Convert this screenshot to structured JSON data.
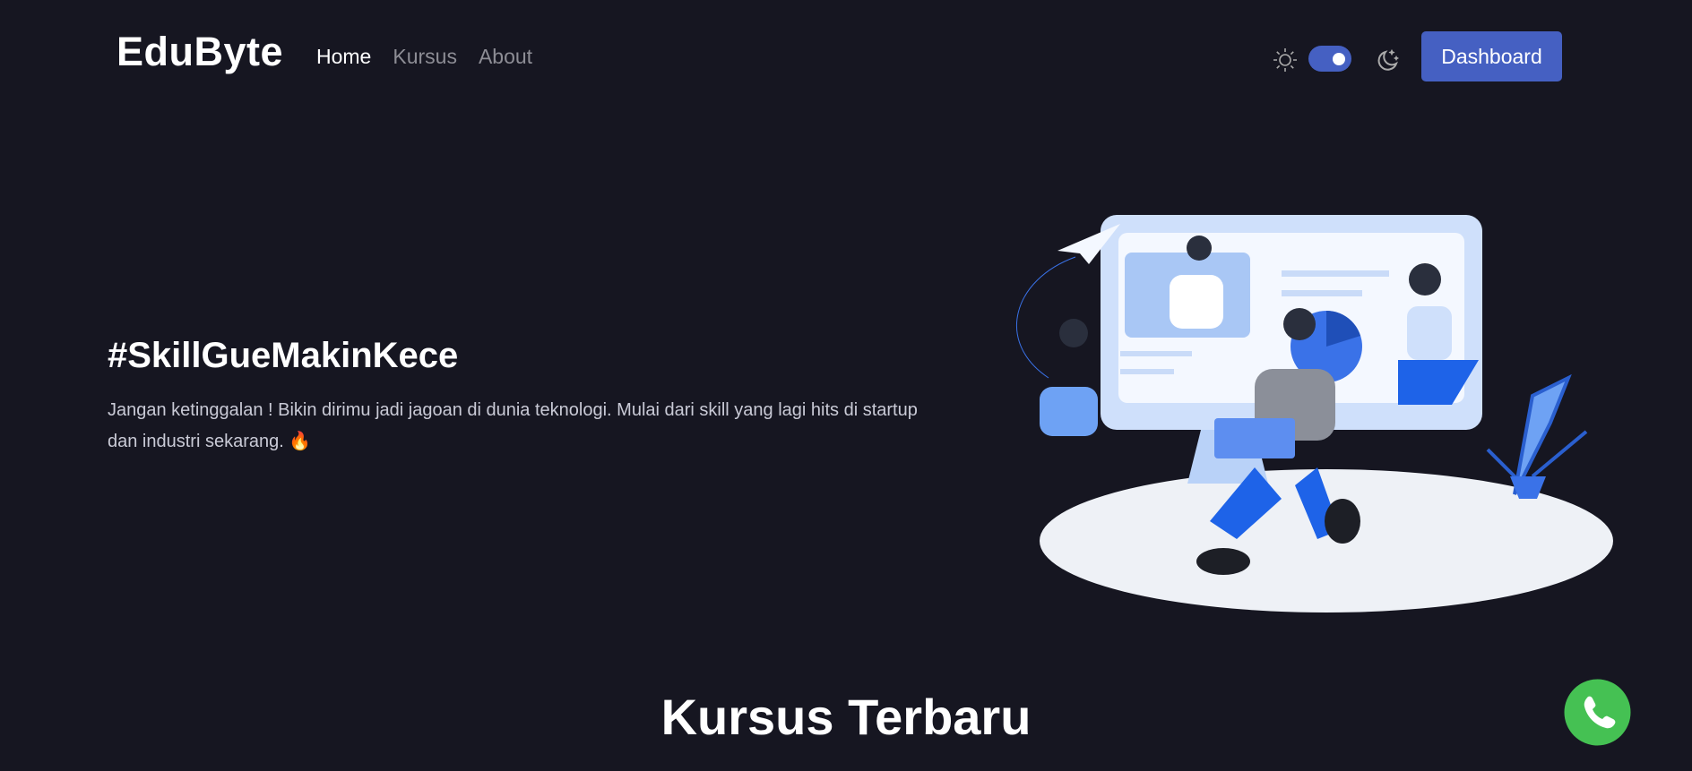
{
  "nav": {
    "brand": "EduByte",
    "links": [
      {
        "label": "Home",
        "active": true
      },
      {
        "label": "Kursus",
        "active": false
      },
      {
        "label": "About",
        "active": false
      }
    ],
    "theme_toggle": {
      "light_icon": "sun-icon",
      "dark_icon": "moon-stars-icon",
      "dark_mode": true
    },
    "dashboard_label": "Dashboard"
  },
  "hero": {
    "title": "#SkillGueMakinKece",
    "text": "Jangan ketinggalan ! Bikin dirimu jadi jagoan di dunia teknologi. Mulai dari skill yang lagi hits di startup dan industri sekarang. 🔥"
  },
  "section": {
    "title": "Kursus Terbaru"
  },
  "colors": {
    "background": "#161621",
    "accent": "#4560c2",
    "whatsapp": "#45c153"
  }
}
